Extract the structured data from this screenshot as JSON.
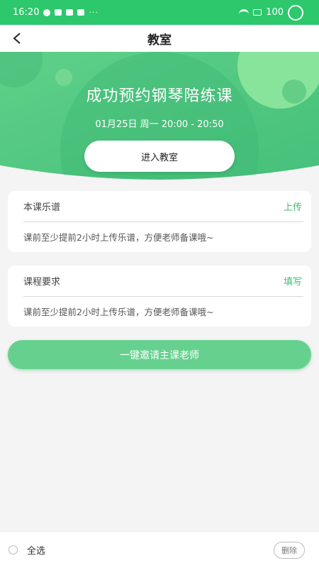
{
  "status_bar": {
    "time": "16:20",
    "dots": "···",
    "battery": "100"
  },
  "nav": {
    "title": "教室",
    "back_icon": "chevron-left-icon"
  },
  "hero": {
    "title": "成功预约钢琴陪练课",
    "schedule": "01月25日 周一 20:00 - 20:50",
    "enter_button": "进入教室",
    "colors": {
      "base": "#4cc47d",
      "light": "#86e49a"
    }
  },
  "sheet_music_card": {
    "label": "本课乐谱",
    "action": "上传",
    "hint": "课前至少提前2小时上传乐谱，方便老师备课哦~"
  },
  "requirements_card": {
    "label": "课程要求",
    "action": "填写",
    "hint": "课前至少提前2小时上传乐谱，方便老师备课哦~"
  },
  "invite_button": "一键邀请主课老师",
  "bottom_bar": {
    "select_all": "全选",
    "delete": "删除"
  },
  "colors": {
    "accent": "#2dc86b",
    "action_text": "#3bbf6e",
    "invite_button": "#66d18f"
  }
}
